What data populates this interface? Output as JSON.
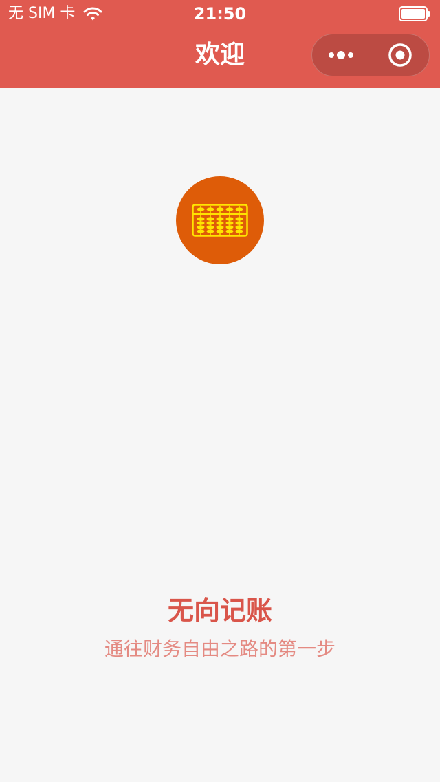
{
  "status_bar": {
    "carrier": "无 SIM 卡",
    "time": "21:50"
  },
  "nav": {
    "title": "欢迎"
  },
  "icons": {
    "wifi": "wifi-icon",
    "battery": "battery-icon",
    "more": "more-dots-icon",
    "close": "target-close-icon",
    "logo": "abacus-icon"
  },
  "colors": {
    "header": "#e05a50",
    "logo_bg": "#de5c08",
    "abacus": "#ffe400",
    "title": "#d9554a",
    "tagline": "#e48a82",
    "background": "#f6f6f6"
  },
  "welcome": {
    "app_name": "无向记账",
    "tagline": "通往财务自由之路的第一步"
  }
}
